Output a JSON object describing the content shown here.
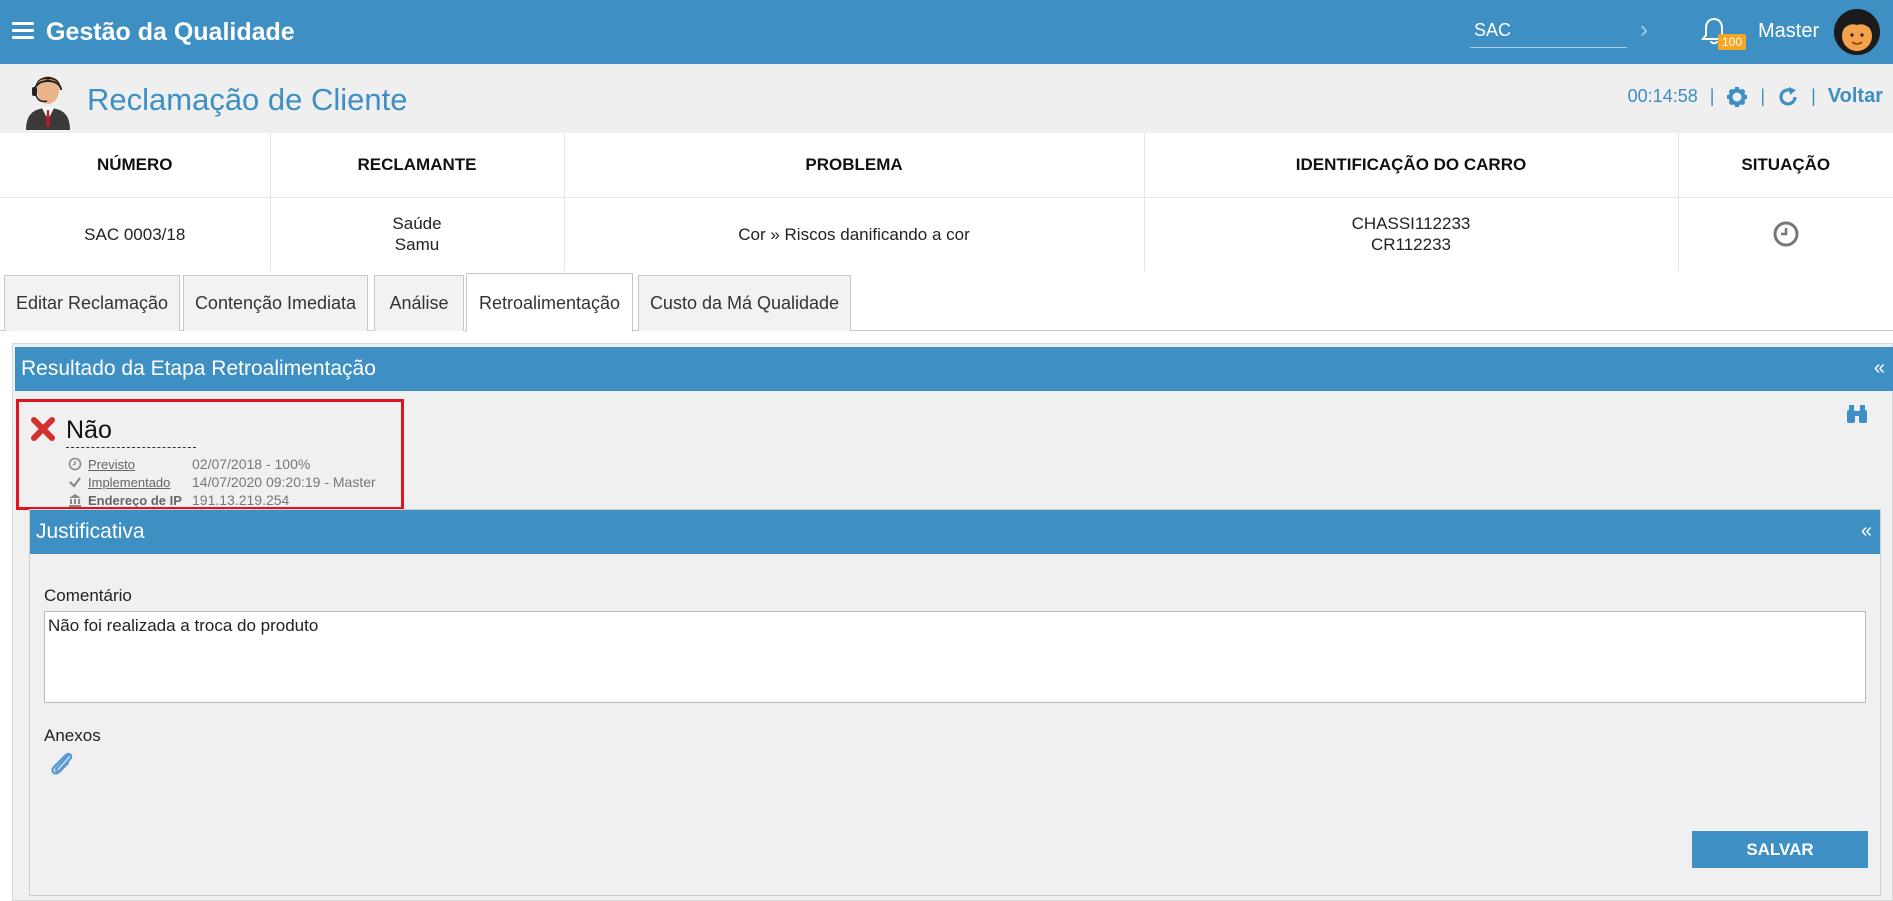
{
  "app": {
    "title": "Gestão da Qualidade",
    "search_value": "SAC",
    "notification_count": "100",
    "user_name": "Master"
  },
  "page": {
    "title": "Reclamação de Cliente",
    "timer": "00:14:58",
    "back_label": "Voltar"
  },
  "table": {
    "headers": [
      "NÚMERO",
      "RECLAMANTE",
      "PROBLEMA",
      "IDENTIFICAÇÃO DO CARRO",
      "SITUAÇÃO"
    ],
    "row": {
      "numero": "SAC 0003/18",
      "reclamante_line1": "Saúde",
      "reclamante_line2": "Samu",
      "problema": "Cor » Riscos danificando a cor",
      "carro_line1": "CHASSI112233",
      "carro_line2": "CR112233",
      "situacao_icon": "clock-icon"
    }
  },
  "tabs": [
    {
      "label": "Editar Reclamação"
    },
    {
      "label": "Contenção Imediata"
    },
    {
      "label": "Análise"
    },
    {
      "label": "Retroalimentação",
      "active": true
    },
    {
      "label": "Custo da Má Qualidade"
    }
  ],
  "result_panel": {
    "title": "Resultado da Etapa Retroalimentação",
    "collapse": "«",
    "status": "Não",
    "previsto_label": "Previsto",
    "previsto_value": "02/07/2018 - 100%",
    "implementado_label": "Implementado",
    "implementado_value": "14/07/2020 09:20:19 - Master",
    "ip_label": "Endereço de IP",
    "ip_value": "191.13.219.254"
  },
  "justificativa": {
    "title": "Justificativa",
    "collapse": "«",
    "comment_label": "Comentário",
    "comment_value": "Não foi realizada a troca do produto",
    "attachments_label": "Anexos",
    "save_label": "SALVAR"
  },
  "colors": {
    "primary": "#3d8fc4",
    "highlight": "#e0141e",
    "badge": "#f5a623"
  }
}
